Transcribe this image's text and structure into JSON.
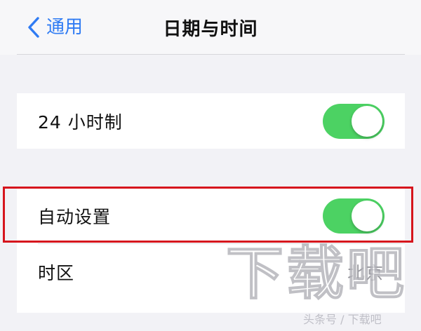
{
  "header": {
    "back_label": "通用",
    "title": "日期与时间"
  },
  "settings": {
    "twenty_four_hour": {
      "label": "24 小时制",
      "enabled": true
    },
    "auto_set": {
      "label": "自动设置",
      "enabled": true
    },
    "time_zone": {
      "label": "时区",
      "value": "北京"
    }
  },
  "watermark": {
    "main": "下载吧",
    "sub": "头条号 / 下载吧"
  },
  "colors": {
    "accent": "#2f7bf3",
    "toggle_on": "#4cd263",
    "highlight": "#d6151d"
  }
}
